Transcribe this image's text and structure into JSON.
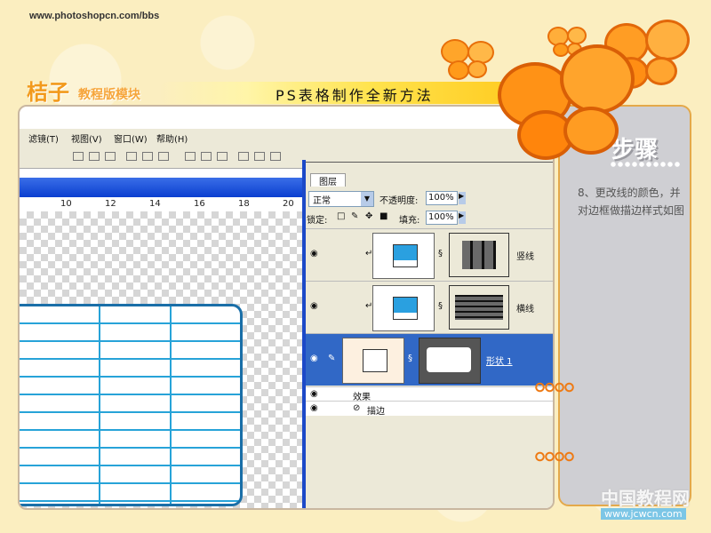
{
  "header": {
    "site_url": "www.photoshopcn.com/bbs",
    "brand": "桔子",
    "brand_sub": "教程版模块",
    "title": "PS表格制作全新方法"
  },
  "menubar": {
    "items": [
      "滤镜(T)",
      "视图(V)",
      "窗口(W)",
      "帮助(H)"
    ]
  },
  "ruler": {
    "ticks": [
      "10",
      "12",
      "14",
      "16",
      "18",
      "20"
    ]
  },
  "layers_panel": {
    "tab_label": "图层",
    "blend_mode": "正常",
    "opacity_label": "不透明度:",
    "opacity_value": "100%",
    "lock_label": "锁定:",
    "fill_label": "填充:",
    "fill_value": "100%",
    "layers": [
      {
        "name": "竖线"
      },
      {
        "name": "横线"
      },
      {
        "name": "形状 1",
        "selected": true
      }
    ],
    "effects_label": "效果",
    "stroke_label": "描边"
  },
  "steps": {
    "heading": "步骤",
    "text": "8、更改线的颜色，并对边框做描边样式如图"
  },
  "watermark": {
    "text": "中国教程网",
    "url": "www.jcwcn.com"
  },
  "colors": {
    "accent_orange": "#f29a1c",
    "ps_blue": "#0a3fd0",
    "table_line": "#27a3d8"
  }
}
